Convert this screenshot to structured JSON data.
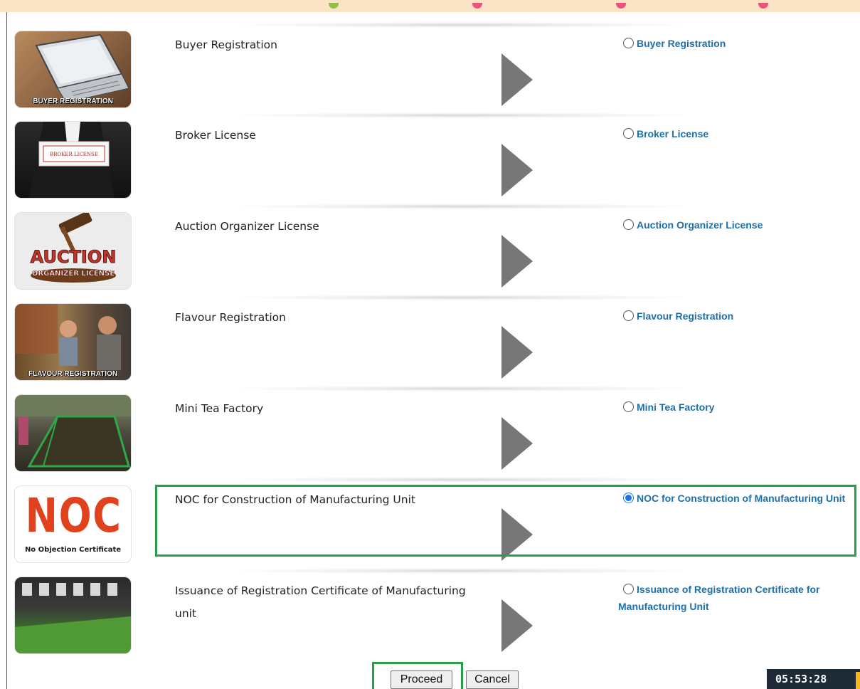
{
  "services": [
    {
      "title": "Buyer Registration",
      "option": "Buyer Registration",
      "thumb_caption": "BUYER REGISTRATION",
      "selected": false,
      "icon": "laptop-image"
    },
    {
      "title": "Broker License",
      "option": "Broker License",
      "thumb_caption": "BROKER LICENSE",
      "selected": false,
      "icon": "broker-card-image"
    },
    {
      "title": "Auction Organizer License",
      "option": "Auction Organizer License",
      "thumb_caption": "AUCTION",
      "thumb_caption_2": "ORGANIZER LICENSE",
      "selected": false,
      "icon": "gavel-image"
    },
    {
      "title": "Flavour Registration",
      "option": "Flavour Registration",
      "thumb_caption": "FLAVOUR REGISTRATION",
      "selected": false,
      "icon": "tea-tasting-image"
    },
    {
      "title": "Mini Tea Factory",
      "option": "Mini Tea Factory",
      "thumb_caption": "",
      "selected": false,
      "icon": "tea-factory-image"
    },
    {
      "title": "NOC for Construction of Manufacturing Unit",
      "option": "NOC for Construction of Manufacturing Unit",
      "thumb_caption": "NOC",
      "thumb_caption_2": "No Objection Certificate",
      "selected": true,
      "icon": "noc-logo"
    },
    {
      "title": "Issuance of Registration Certificate of Manufacturing unit",
      "option": "Issuance of Registration Certificate for Manufacturing Unit",
      "thumb_caption": "",
      "selected": false,
      "icon": "manufacturing-image"
    }
  ],
  "buttons": {
    "proceed": "Proceed",
    "cancel": "Cancel"
  },
  "clock": "05:53:28",
  "colors": {
    "highlight": "#2a9d4a",
    "option_link": "#1f6fa8",
    "arrow": "#777777",
    "top_strip": "#fbe3c6"
  }
}
